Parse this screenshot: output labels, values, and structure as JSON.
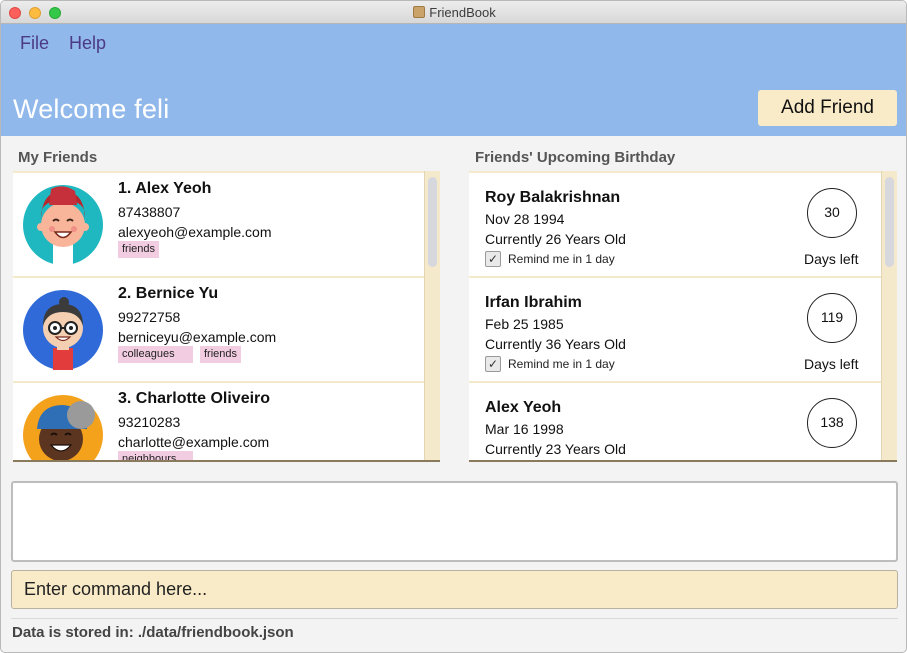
{
  "window": {
    "title": "FriendBook"
  },
  "menu": {
    "file": "File",
    "help": "Help"
  },
  "header": {
    "welcome": "Welcome  feli",
    "add_friend": "Add Friend"
  },
  "friends_panel": {
    "title": "My Friends",
    "friends": [
      {
        "name": "1.  Alex Yeoh",
        "phone": "87438807",
        "email": "alexyeoh@example.com",
        "tags": [
          "friends"
        ],
        "avatar": "avatar-red-cap"
      },
      {
        "name": "2.  Bernice Yu",
        "phone": "99272758",
        "email": "berniceyu@example.com",
        "tags": [
          "colleagues",
          "friends"
        ],
        "avatar": "avatar-glasses"
      },
      {
        "name": "3.  Charlotte Oliveiro",
        "phone": "93210283",
        "email": "charlotte@example.com",
        "tags": [
          "neighbours"
        ],
        "avatar": "avatar-grey-cap"
      }
    ]
  },
  "birthday_panel": {
    "title": "Friends' Upcoming Birthday",
    "days_left_label": "Days left",
    "remind_label": "Remind me in 1 day",
    "items": [
      {
        "name": "Roy Balakrishnan",
        "date": "Nov 28 1994",
        "age": "Currently 26 Years Old",
        "days": "30",
        "remind": true
      },
      {
        "name": "Irfan Ibrahim",
        "date": "Feb 25 1985",
        "age": "Currently 36 Years Old",
        "days": "119",
        "remind": true
      },
      {
        "name": "Alex Yeoh",
        "date": "Mar 16 1998",
        "age": "Currently 23 Years Old",
        "days": "138",
        "remind": false
      }
    ]
  },
  "command": {
    "placeholder": "Enter command here..."
  },
  "status": {
    "text": "Data is stored in: ./data/friendbook.json"
  },
  "colors": {
    "header": "#91b8ea",
    "accent": "#f9ebc8",
    "tag": "#f2cde1",
    "menu_text": "#4b3a86"
  }
}
